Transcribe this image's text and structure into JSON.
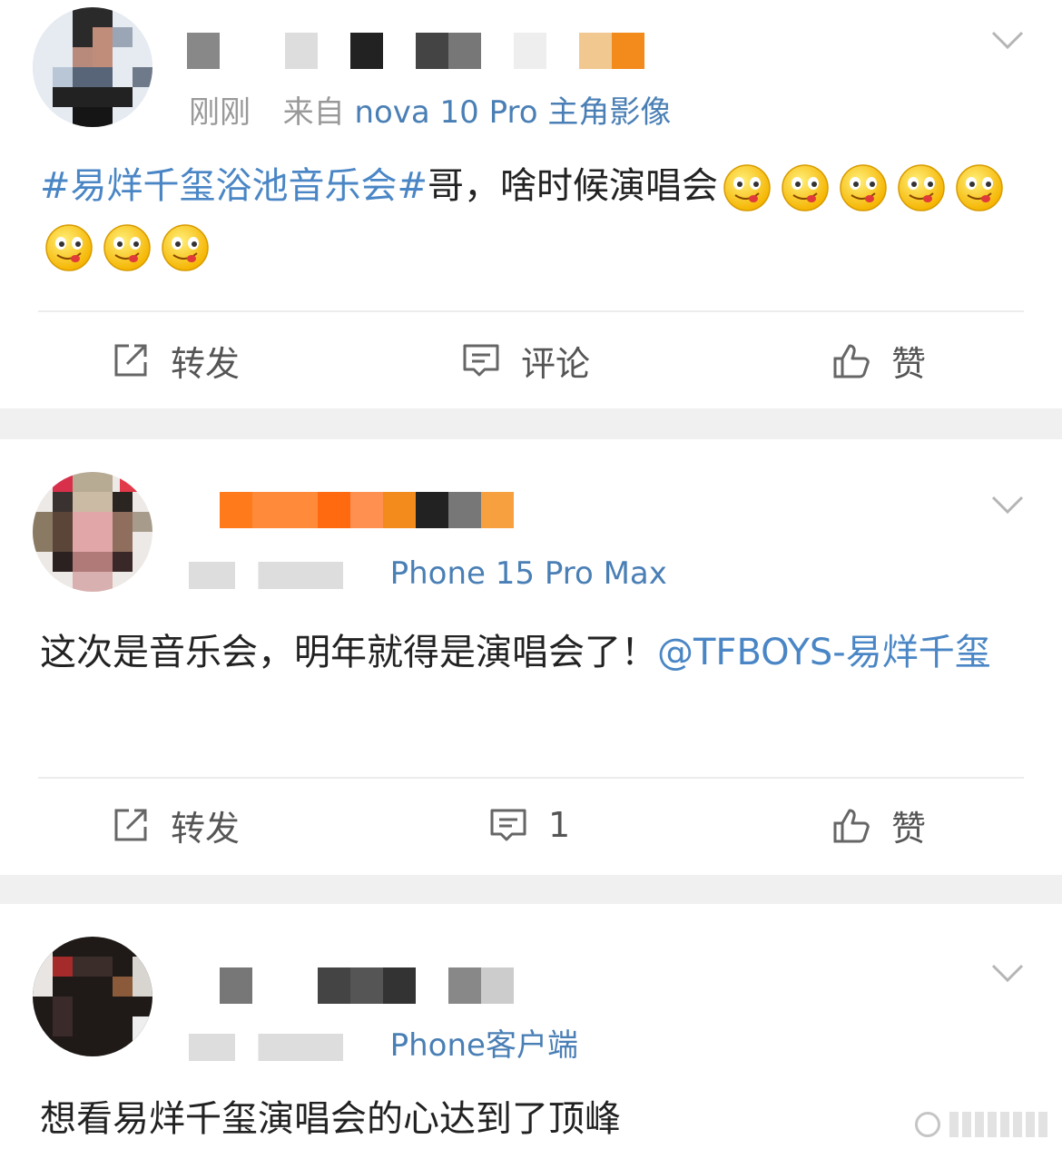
{
  "colors": {
    "link": "#4a86c5",
    "source": "#4a7fb5",
    "meta": "#999999",
    "separator": "#f0f0f0"
  },
  "posts": [
    {
      "time": "刚刚",
      "source_prefix": "来自",
      "source": "nova 10 Pro 主角影像",
      "hashtag": "#易烊千玺浴池音乐会#",
      "text": "哥，啥时候演唱会",
      "emoji_count": 8,
      "emoji_name": "drooling-face-icon",
      "actions": {
        "repost": "转发",
        "comment": "评论",
        "like": "赞"
      }
    },
    {
      "source": "Phone 15 Pro Max",
      "text": "这次是音乐会，明年就得是演唱会了！",
      "mention": "@TFBOYS-易烊千玺",
      "actions": {
        "repost": "转发",
        "comment": "1",
        "like": "赞"
      }
    },
    {
      "source": "Phone客户端",
      "text": "想看易烊千玺演唱会的心达到了顶峰"
    }
  ],
  "icons": [
    "chevron-down-icon",
    "repost-icon",
    "comment-icon",
    "like-icon"
  ]
}
